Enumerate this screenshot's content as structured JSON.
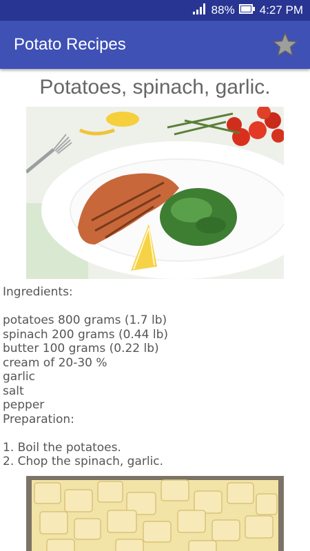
{
  "status_bar": {
    "battery": "88%",
    "time": "4:27 PM"
  },
  "app_bar": {
    "title": "Potato Recipes",
    "favorite_icon": "star-icon"
  },
  "recipe": {
    "title": "Potatoes, spinach, garlic.",
    "ingredients_heading": "Ingredients:",
    "ingredients": [
      "potatoes 800 grams (1.7 lb)",
      "spinach 200 grams (0.44 lb)",
      "butter 100 grams (0.22 lb)",
      "cream of 20-30 %",
      "garlic",
      "salt",
      "pepper"
    ],
    "preparation_heading": "Preparation:",
    "steps": [
      "1. Boil the potatoes.",
      "2. Chop the spinach, garlic."
    ]
  },
  "colors": {
    "status_bar": "#283593",
    "app_bar": "#3f51b5",
    "title_text": "#666666",
    "body_text": "#555555"
  }
}
